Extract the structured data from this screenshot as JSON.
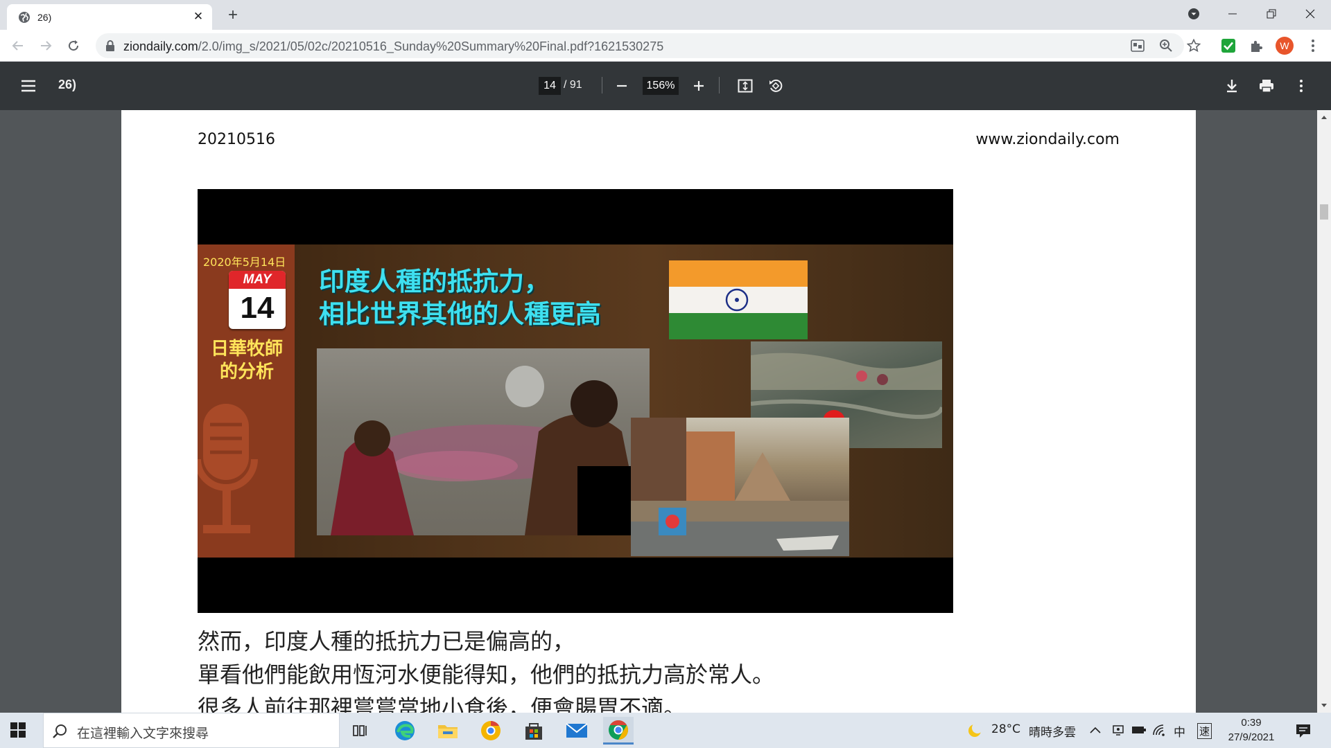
{
  "browser": {
    "tab_title": "26)",
    "tab_close": "✕",
    "new_tab": "+",
    "url_host": "ziondaily.com",
    "url_path": "/2.0/img_s/2021/05/02c/20210516_Sunday%20Summary%20Final.pdf?1621530275",
    "avatar_letter": "W"
  },
  "pdf_toolbar": {
    "title": "26)",
    "current_page": "14",
    "total_pages": "/ 91",
    "zoom": "156%"
  },
  "document": {
    "header_date": "20210516",
    "header_site": "www.ziondaily.com",
    "thumbnail": {
      "date_label": "2020年5月14日",
      "calendar_month": "MAY",
      "calendar_day": "14",
      "pastor_line1": "日華牧師",
      "pastor_line2": "的分析",
      "headline_line1": "印度人種的抵抗力，",
      "headline_line2": "相比世界其他的人種更高"
    },
    "body_lines": [
      "然而，印度人種的抵抗力已是偏高的，",
      "單看他們能飲用恆河水便能得知，他們的抵抗力高於常人。",
      "很多人前往那裡嘗嘗當地小食後，便會腸胃不適。"
    ]
  },
  "taskbar": {
    "search_placeholder": "在這裡輸入文字來搜尋",
    "weather_temp": "28°C",
    "weather_text": "晴時多雲",
    "ime_lang": "中",
    "ime_mode": "速",
    "time": "0:39",
    "date": "27/9/2021"
  },
  "colors": {
    "pdf_toolbar": "#323639",
    "viewer_bg": "#525659",
    "headline": "#3ee0f0",
    "pastor_text": "#ffe45a",
    "avatar": "#e8552b"
  }
}
